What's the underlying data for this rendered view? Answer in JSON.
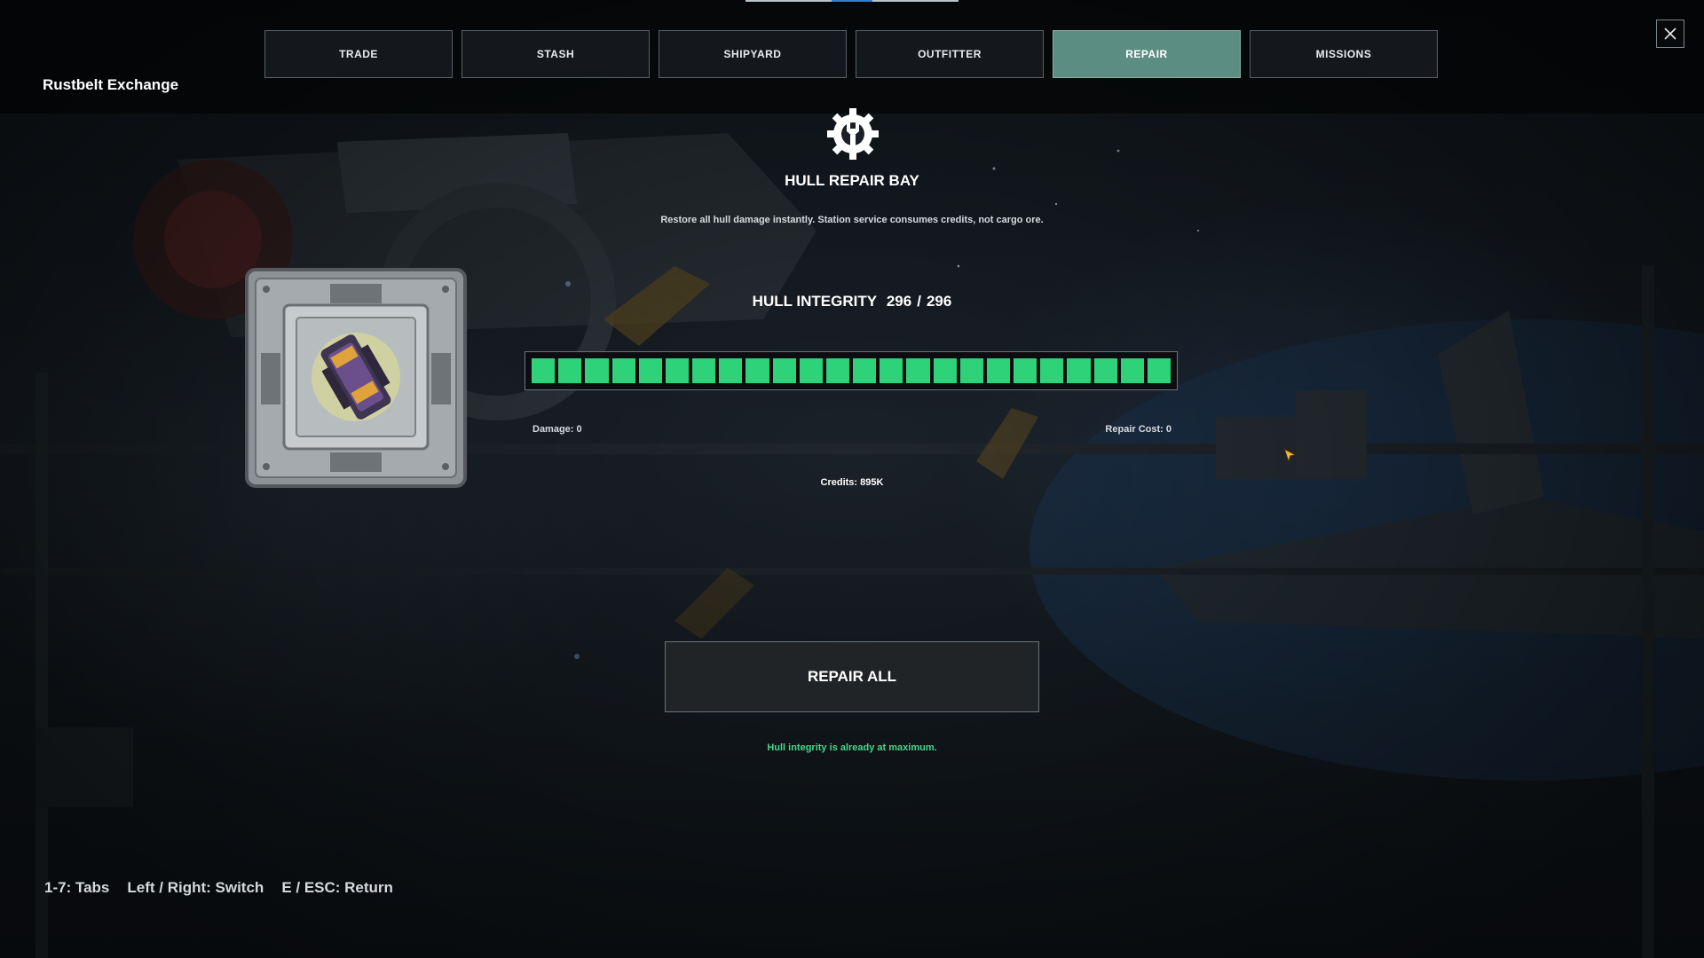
{
  "station": {
    "name": "Rustbelt Exchange"
  },
  "tabs": [
    {
      "label": "TRADE",
      "active": false
    },
    {
      "label": "STASH",
      "active": false
    },
    {
      "label": "SHIPYARD",
      "active": false
    },
    {
      "label": "OUTFITTER",
      "active": false
    },
    {
      "label": "REPAIR",
      "active": true
    },
    {
      "label": "MISSIONS",
      "active": false
    }
  ],
  "icons": {
    "close": "close-icon",
    "header": "wrench-gear-icon",
    "ship": "ship-icon",
    "cursor": "cursor-icon"
  },
  "repair": {
    "title": "HULL REPAIR BAY",
    "description": "Restore all hull damage instantly. Station service consumes credits, not cargo ore.",
    "hull_label": "HULL INTEGRITY",
    "hull_current": "296",
    "hull_separator": "/",
    "hull_max": "296",
    "hull_fraction": 1.0,
    "segments": 24,
    "damage_text": "Damage: 0",
    "repair_cost_text": "Repair Cost: 0",
    "credits_text": "Credits: 895K",
    "button_label": "REPAIR ALL",
    "status_message": "Hull integrity is already at maximum."
  },
  "hints": [
    {
      "text": "1-7: Tabs"
    },
    {
      "text": "Left / Right: Switch"
    },
    {
      "text": "E / ESC: Return"
    }
  ],
  "colors": {
    "accent_active_tab": "#5c8d83",
    "hull_fill": "#2ed379",
    "status_ok": "#47d58a"
  }
}
